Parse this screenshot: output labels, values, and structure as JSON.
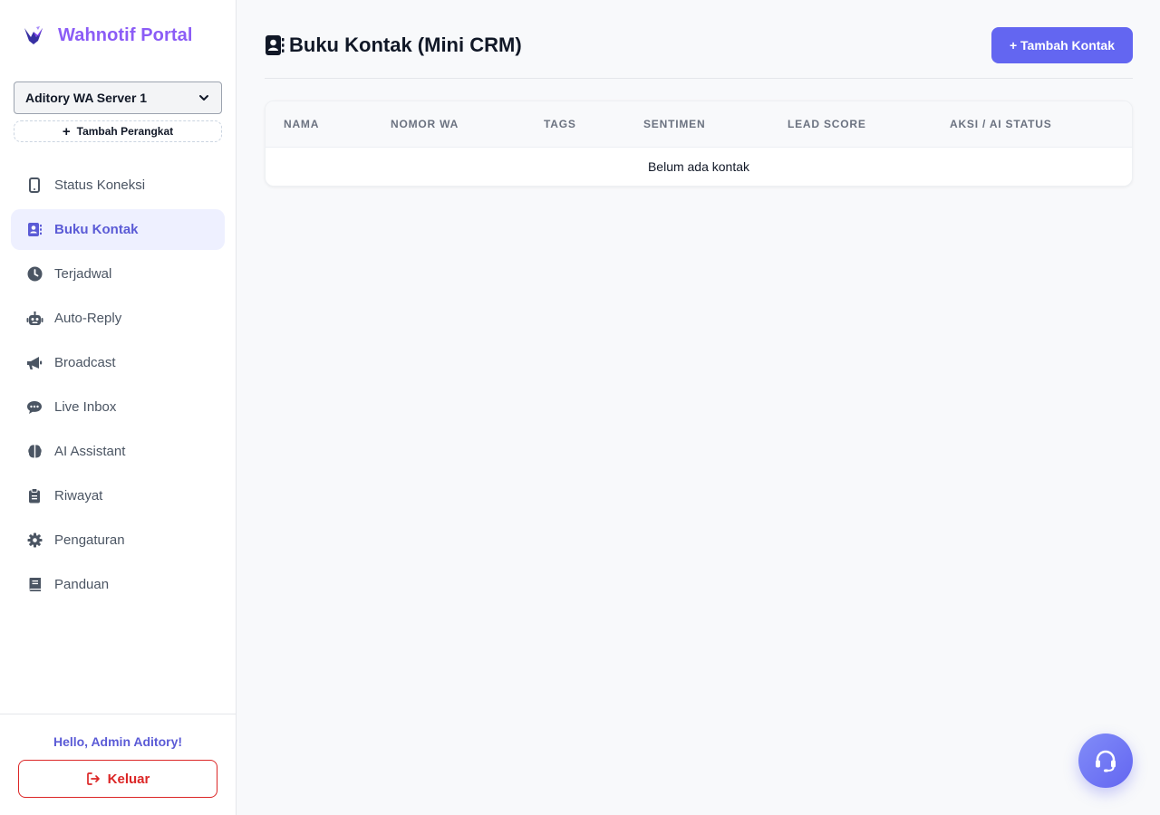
{
  "brand": {
    "title": "Wahnotif Portal",
    "logo_icon": "bird-logo-icon",
    "color": "#8b5cf6"
  },
  "device": {
    "selected": "Aditory WA Server 1",
    "add_label": "Tambah Perangkat"
  },
  "sidebar": {
    "items": [
      {
        "label": "Status Koneksi",
        "icon": "mobile-icon",
        "active": false
      },
      {
        "label": "Buku Kontak",
        "icon": "address-book-icon",
        "active": true
      },
      {
        "label": "Terjadwal",
        "icon": "clock-icon",
        "active": false
      },
      {
        "label": "Auto-Reply",
        "icon": "robot-icon",
        "active": false
      },
      {
        "label": "Broadcast",
        "icon": "megaphone-icon",
        "active": false
      },
      {
        "label": "Live Inbox",
        "icon": "chat-icon",
        "active": false
      },
      {
        "label": "AI Assistant",
        "icon": "brain-icon",
        "active": false
      },
      {
        "label": "Riwayat",
        "icon": "clipboard-icon",
        "active": false
      },
      {
        "label": "Pengaturan",
        "icon": "gear-icon",
        "active": false
      },
      {
        "label": "Panduan",
        "icon": "book-icon",
        "active": false
      }
    ],
    "greeting": "Hello, Admin Aditory!",
    "logout_label": "Keluar"
  },
  "header": {
    "title": "Buku Kontak (Mini CRM)",
    "add_button": "+ Tambah Kontak"
  },
  "table": {
    "columns": [
      "NAMA",
      "NOMOR WA",
      "TAGS",
      "SENTIMEN",
      "LEAD SCORE",
      "AKSI / AI STATUS"
    ],
    "empty_text": "Belum ada kontak"
  },
  "colors": {
    "accent": "#6366f1",
    "active_text": "#5b5bd6",
    "active_bg": "#eef0ff",
    "danger": "#dc2626"
  }
}
